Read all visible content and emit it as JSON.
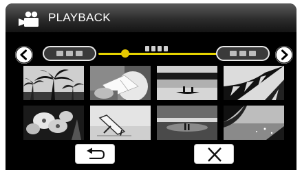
{
  "header": {
    "title": "PLAYBACK",
    "mode_icon": "video-camera-icon"
  },
  "navigation": {
    "prev_icon": "chevron-left-icon",
    "next_icon": "chevron-right-icon",
    "slider_position": 0.2
  },
  "thumbnails": [
    {
      "scene": "palm-trees-sky"
    },
    {
      "scene": "person-reading"
    },
    {
      "scene": "lake-canoe"
    },
    {
      "scene": "palm-leaves-silhouette"
    },
    {
      "scene": "flowers-closeup"
    },
    {
      "scene": "beach-lounge-chair"
    },
    {
      "scene": "couple-sunset-sea"
    },
    {
      "scene": "palm-beach-sparkle"
    }
  ],
  "footer": {
    "back_icon": "return-arrow-icon",
    "close_icon": "close-x-icon"
  },
  "colors": {
    "slider_accent": "#e6d400",
    "panel_bg": "#000000"
  }
}
